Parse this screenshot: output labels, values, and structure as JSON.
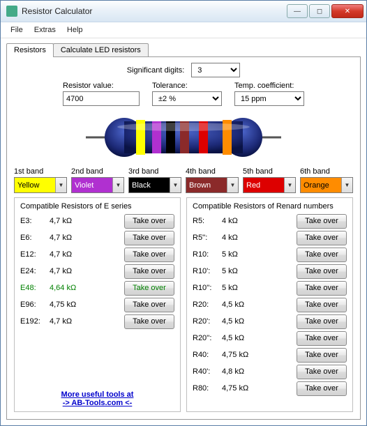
{
  "title": "Resistor Calculator",
  "menu": {
    "file": "File",
    "extras": "Extras",
    "help": "Help"
  },
  "tabs": {
    "resistors": "Resistors",
    "led": "Calculate LED resistors"
  },
  "labels": {
    "sigdigits": "Significant digits:",
    "resval": "Resistor value:",
    "tolerance": "Tolerance:",
    "tempco": "Temp. coefficient:"
  },
  "fields": {
    "sigdigits": "3",
    "resval": "4700",
    "tolerance": "±2 %",
    "tempco": "15 ppm"
  },
  "bandlabels": [
    "1st band",
    "2nd band",
    "3rd band",
    "4th band",
    "5th band",
    "6th band"
  ],
  "bandvalues": [
    "Yellow",
    "Violet",
    "Black",
    "Brown",
    "Red",
    "Orange"
  ],
  "btn_takeover": "Take over",
  "eseries": {
    "title": "Compatible Resistors of E series",
    "rows": [
      {
        "code": "E3:",
        "val": "4,7 kΩ",
        "hl": false
      },
      {
        "code": "E6:",
        "val": "4,7 kΩ",
        "hl": false
      },
      {
        "code": "E12:",
        "val": "4,7 kΩ",
        "hl": false
      },
      {
        "code": "E24:",
        "val": "4,7 kΩ",
        "hl": false
      },
      {
        "code": "E48:",
        "val": "4,64 kΩ",
        "hl": true
      },
      {
        "code": "E96:",
        "val": "4,75 kΩ",
        "hl": false
      },
      {
        "code": "E192:",
        "val": "4,7 kΩ",
        "hl": false
      }
    ]
  },
  "renard": {
    "title": "Compatible Resistors of Renard numbers",
    "rows": [
      {
        "code": "R5:",
        "val": "4 kΩ"
      },
      {
        "code": "R5'':",
        "val": "4 kΩ"
      },
      {
        "code": "R10:",
        "val": "5 kΩ"
      },
      {
        "code": "R10':",
        "val": "5 kΩ"
      },
      {
        "code": "R10'':",
        "val": "5 kΩ"
      },
      {
        "code": "R20:",
        "val": "4,5 kΩ"
      },
      {
        "code": "R20':",
        "val": "4,5 kΩ"
      },
      {
        "code": "R20'':",
        "val": "4,5 kΩ"
      },
      {
        "code": "R40:",
        "val": "4,75 kΩ"
      },
      {
        "code": "R40':",
        "val": "4,8 kΩ"
      },
      {
        "code": "R80:",
        "val": "4,75 kΩ"
      }
    ]
  },
  "link": {
    "l1": "More useful tools at",
    "l2": "-> AB-Tools.com <-"
  },
  "bandclasses": [
    "yellow",
    "violet",
    "black",
    "brown",
    "red",
    "orange"
  ]
}
